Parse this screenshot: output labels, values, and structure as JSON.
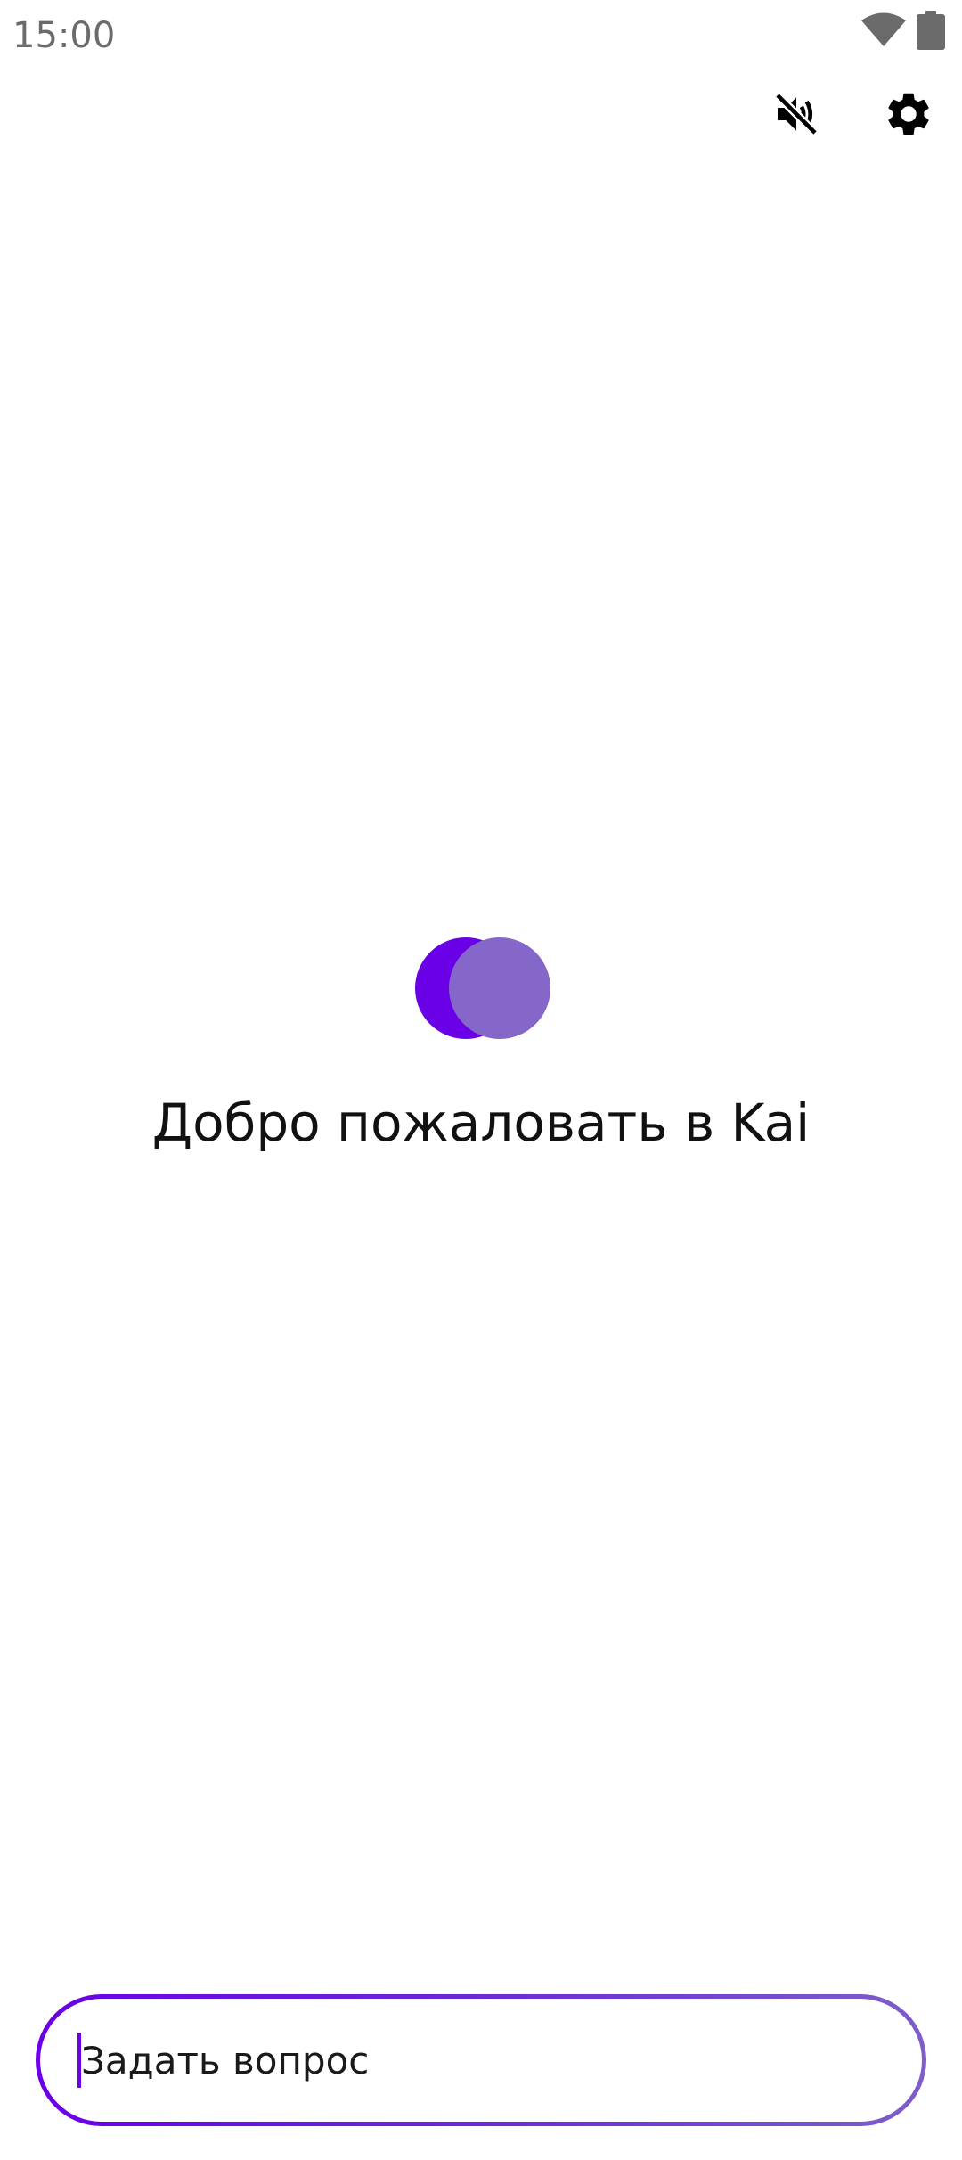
{
  "status_bar": {
    "time": "15:00",
    "wifi_icon": "wifi-icon",
    "battery_icon": "battery-icon"
  },
  "toolbar": {
    "mute_icon": "volume-off-icon",
    "settings_icon": "gear-icon"
  },
  "welcome": {
    "logo": "kai-logo",
    "title": "Добро пожаловать в Kai"
  },
  "composer": {
    "placeholder": "Задать вопрос",
    "value": ""
  },
  "colors": {
    "accent": "#6a00e6",
    "accent_light": "#8566c9",
    "text": "#111111",
    "status_text": "#6b6b6b",
    "background": "#ffffff"
  }
}
